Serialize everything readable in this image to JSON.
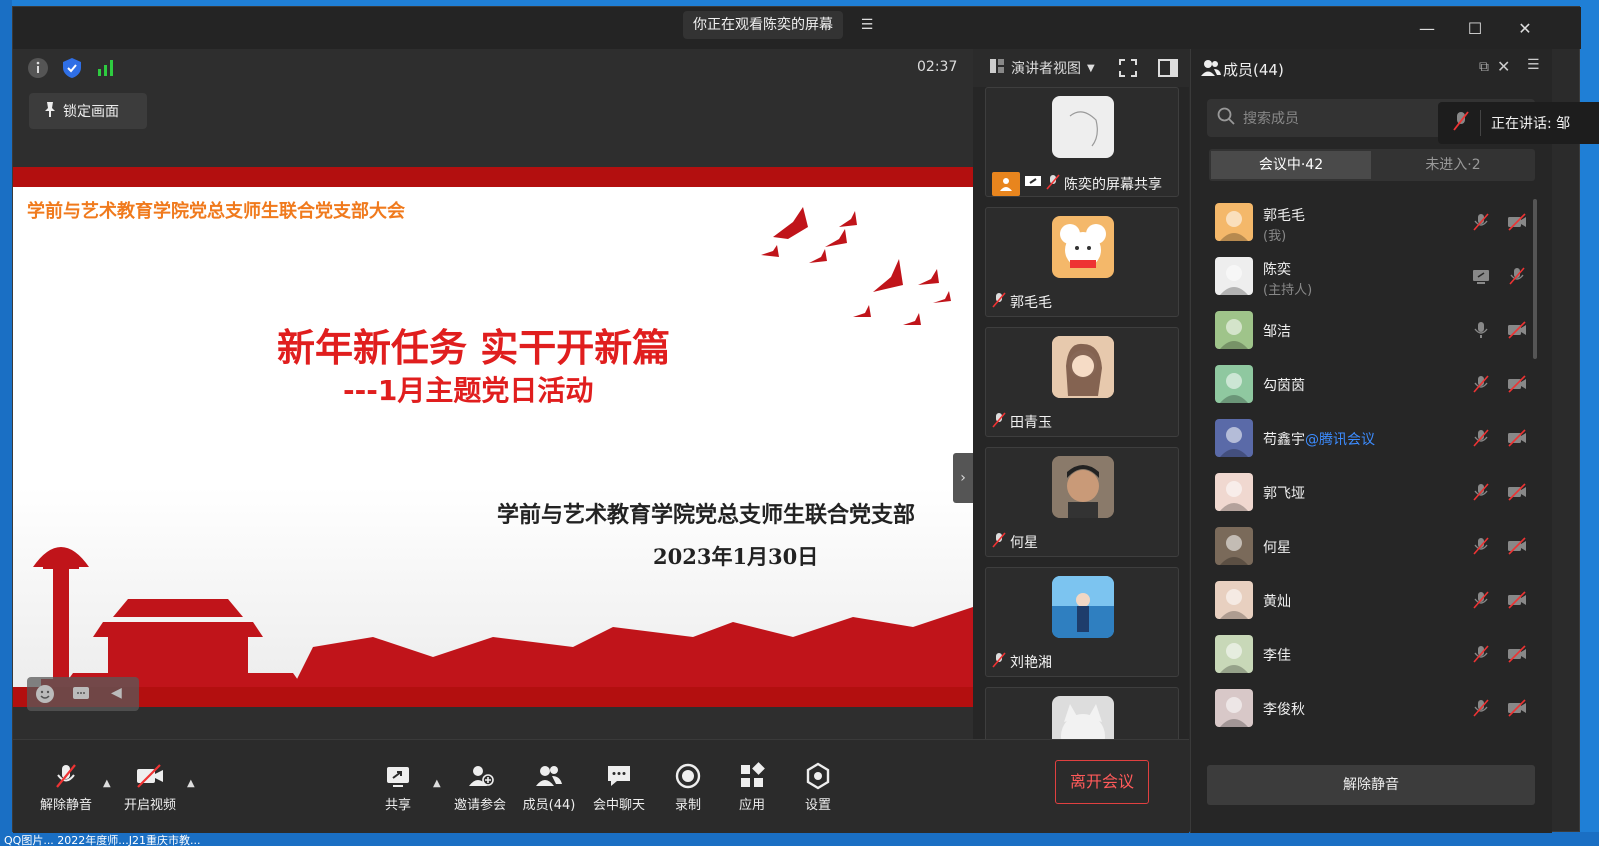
{
  "window": {
    "title": "你正在观看陈奕的屏幕",
    "controls": [
      "minimize",
      "maximize",
      "close"
    ]
  },
  "topbar": {
    "timer": "02:37",
    "view_mode": "演讲者视图",
    "lock_label": "锁定画面"
  },
  "slide": {
    "header": "学前与艺术教育学院党总支师生联合党支部大会",
    "title": "新年新任务  实干开新篇",
    "subtitle": "---1月主题党日活动",
    "organization": "学前与艺术教育学院党总支师生联合党支部",
    "date": "2023年1月30日",
    "colors": {
      "banner": "#b30f0f",
      "title": "#e01e1e",
      "header": "#f07a1d"
    }
  },
  "video_tiles": [
    {
      "name": "陈奕的屏幕共享",
      "avatar": "white-sketch"
    },
    {
      "name": "郭毛毛",
      "avatar": "mouse-cartoon"
    },
    {
      "name": "田青玉",
      "avatar": "photo-girl"
    },
    {
      "name": "何星",
      "avatar": "photo-boy"
    },
    {
      "name": "刘艳湘",
      "avatar": "photo-sea"
    },
    {
      "name": "",
      "avatar": "cat"
    }
  ],
  "toolbar": {
    "unmute": "解除静音",
    "video": "开启视频",
    "share": "共享",
    "invite": "邀请参会",
    "members": "成员(44)",
    "chat": "会中聊天",
    "record": "录制",
    "apps": "应用",
    "settings": "设置",
    "leave": "离开会议"
  },
  "panel": {
    "title": "成员(44)",
    "search_placeholder": "搜索成员",
    "tab_in_meeting": "会议中·42",
    "tab_not_joined": "未进入·2",
    "unmute_all": "解除静音",
    "members": [
      {
        "name": "郭毛毛",
        "role": "(我)",
        "mic": "muted",
        "cam": "off"
      },
      {
        "name": "陈奕",
        "role": "(主持人)",
        "mic": "screen",
        "cam": "muted"
      },
      {
        "name": "邹洁",
        "role": "",
        "mic": "on",
        "cam": "off"
      },
      {
        "name": "勾茵茵",
        "role": "",
        "mic": "muted",
        "cam": "off"
      },
      {
        "name": "苟鑫宇",
        "suffix": "@腾讯会议",
        "role": "",
        "mic": "muted",
        "cam": "off"
      },
      {
        "name": "郭飞垭",
        "role": "",
        "mic": "muted",
        "cam": "off"
      },
      {
        "name": "何星",
        "role": "",
        "mic": "muted",
        "cam": "off"
      },
      {
        "name": "黄灿",
        "role": "",
        "mic": "muted",
        "cam": "off"
      },
      {
        "name": "李佳",
        "role": "",
        "mic": "muted",
        "cam": "off"
      },
      {
        "name": "李俊秋",
        "role": "",
        "mic": "muted",
        "cam": "off"
      }
    ]
  },
  "speaking": {
    "label": "正在讲话: 邹"
  },
  "desktop": {
    "bottom_text": "QQ图片...  2022年度师...J21重庆市教..."
  }
}
